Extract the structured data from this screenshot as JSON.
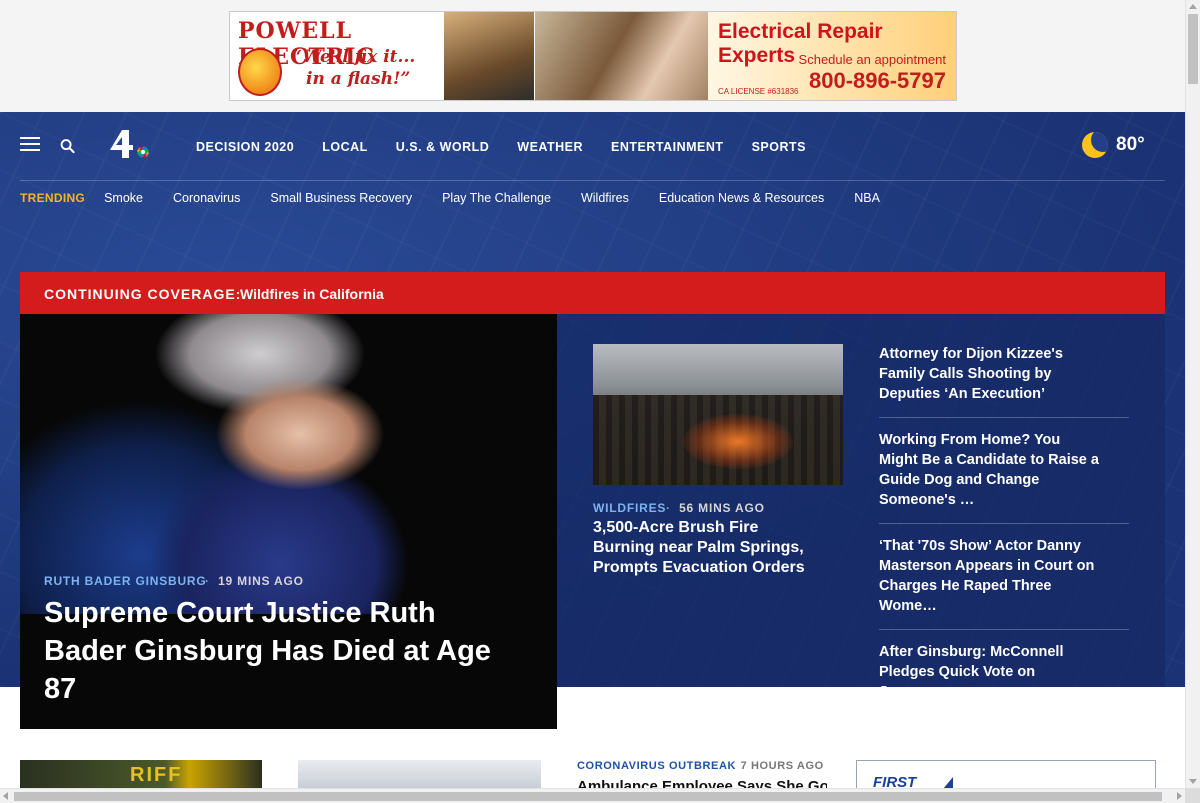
{
  "ad": {
    "brand": "POWELL ELECTRIC",
    "tagline_line1": "“We'll fix it...",
    "tagline_line2": "in a flash!”",
    "headline": "Electrical Repair Experts",
    "schedule": "Schedule an appointment",
    "phone": "800-896-5797",
    "license": "CA LICENSE #631836"
  },
  "nav": {
    "items": [
      "DECISION 2020",
      "LOCAL",
      "U.S. & WORLD",
      "WEATHER",
      "ENTERTAINMENT",
      "SPORTS"
    ],
    "weather_icon": "moon-icon",
    "temperature": "80°"
  },
  "trending": {
    "label": "TRENDING",
    "items": [
      "Smoke",
      "Coronavirus",
      "Small Business Recovery",
      "Play The Challenge",
      "Wildfires",
      "Education News & Resources",
      "NBA"
    ]
  },
  "coverage": {
    "label": "CONTINUING COVERAGE:",
    "link": "Wildfires in California"
  },
  "lead": {
    "tag": "RUTH BADER GINSBURG",
    "time": "19 MINS AGO",
    "title": "Supreme Court Justice Ruth Bader Ginsburg Has Died at Age 87"
  },
  "secondary": {
    "tag": "WILDFIRES",
    "time": "56 MINS AGO",
    "title": "3,500-Acre Brush Fire Burning near Palm Springs, Prompts Evacuation Orders"
  },
  "headlines": [
    "Attorney for Dijon Kizzee's Family Calls Shooting by Deputies ‘An Execution’",
    "Working From Home? You Might Be a Candidate to Raise a Guide Dog and Change Someone's …",
    "‘That '70s Show’ Actor Danny Masterson Appears in Court on Charges He Raped Three Wome…",
    "After Ginsburg: McConnell Pledges Quick Vote on Successor"
  ],
  "below": {
    "card1_text": "RIFF",
    "co_tag": "CORONAVIRUS OUTBREAK",
    "co_time": "7 HOURS AGO",
    "co_title": "Ambulance Employee Says She Got",
    "first_text": "FIRST"
  },
  "colors": {
    "brand_blue": "#1b3374",
    "alert_red": "#d51c1c",
    "trending_gold": "#f5b81c",
    "tag_blue": "#7db4f0"
  }
}
